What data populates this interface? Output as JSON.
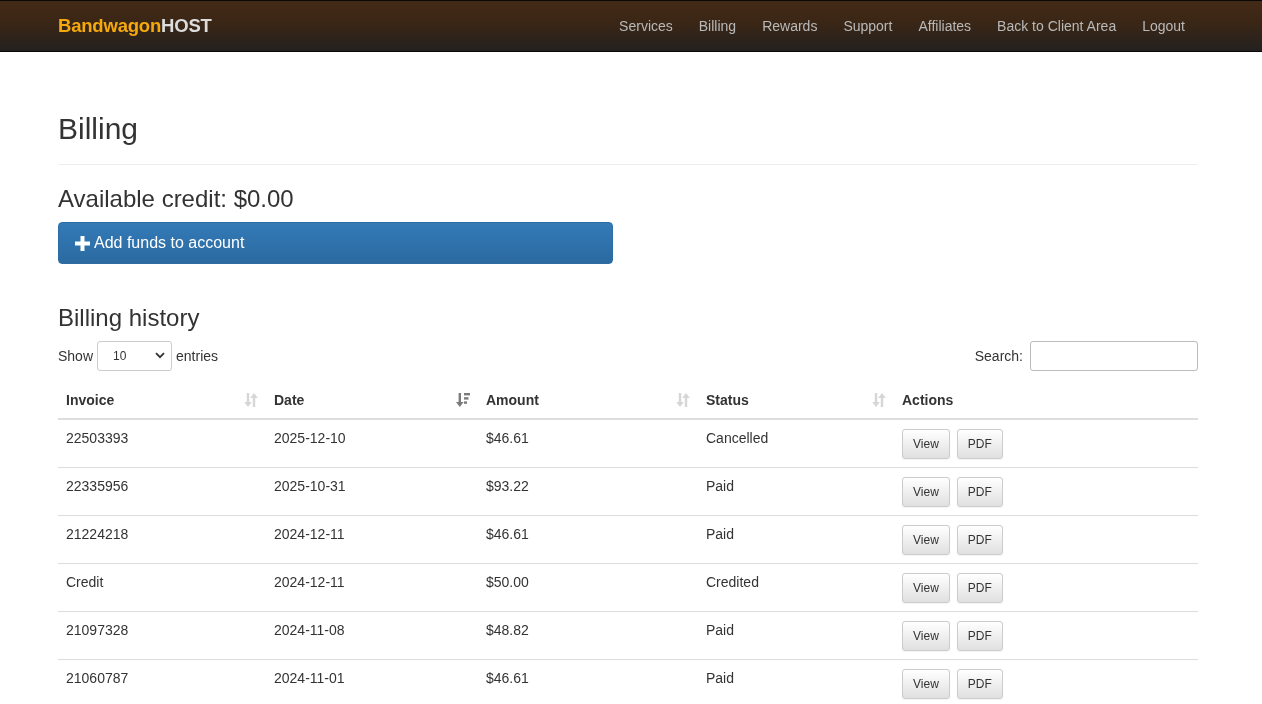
{
  "navbar": {
    "brand": {
      "name": "Bandwagon",
      "suffix": "HOST"
    },
    "links": [
      "Services",
      "Billing",
      "Rewards",
      "Support",
      "Affiliates",
      "Back to Client Area",
      "Logout"
    ]
  },
  "page_title": "Billing",
  "credit": "Available credit: $0.00",
  "add_funds_button": {
    "label": "Add funds to account"
  },
  "history": {
    "title": "Billing history",
    "length_menu": {
      "before": "Show",
      "value": "10",
      "after": "entries"
    },
    "search": {
      "label": "Search:"
    }
  },
  "table": {
    "columns": [
      {
        "label": "Invoice",
        "kind": "sortable"
      },
      {
        "label": "Date",
        "kind": "sorted_descending"
      },
      {
        "label": "Amount",
        "kind": "sortable"
      },
      {
        "label": "Status",
        "kind": "sortable"
      },
      {
        "label": "Actions",
        "kind": "plain"
      }
    ],
    "rows": [
      {
        "invoice": "22503393",
        "date": "2025-12-10",
        "amount": "$46.61",
        "status": "Cancelled",
        "actions": [
          "View",
          "PDF"
        ]
      },
      {
        "invoice": "22335956",
        "date": "2025-10-31",
        "amount": "$93.22",
        "status": "Paid",
        "actions": [
          "View",
          "PDF"
        ]
      },
      {
        "invoice": "21224218",
        "date": "2024-12-11",
        "amount": "$46.61",
        "status": "Paid",
        "actions": [
          "View",
          "PDF"
        ]
      },
      {
        "invoice": "Credit",
        "date": "2024-12-11",
        "amount": "$50.00",
        "status": "Credited",
        "actions": [
          "View",
          "PDF"
        ]
      },
      {
        "invoice": "21097328",
        "date": "2024-11-08",
        "amount": "$48.82",
        "status": "Paid",
        "actions": [
          "View",
          "PDF"
        ]
      },
      {
        "invoice": "21060787",
        "date": "2024-11-01",
        "amount": "$46.61",
        "status": "Paid",
        "actions": [
          "View",
          "PDF"
        ]
      }
    ]
  }
}
